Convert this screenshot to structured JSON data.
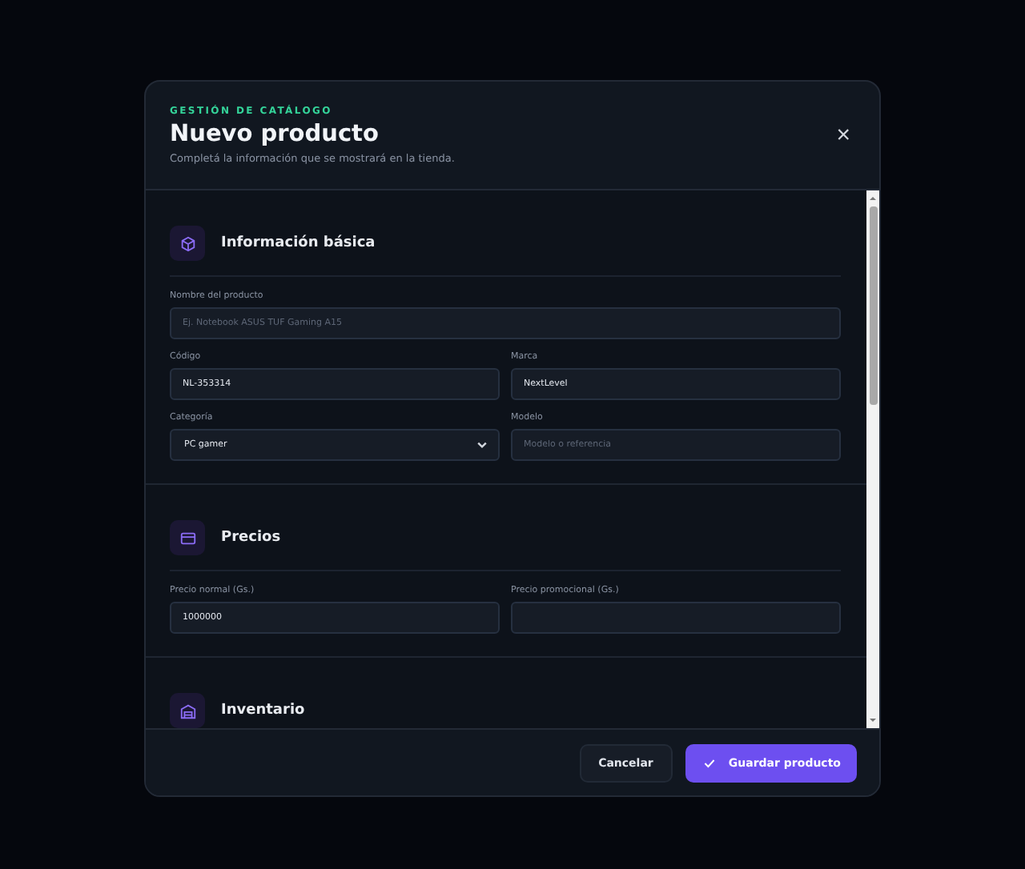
{
  "dialog": {
    "eyebrow": "GESTIÓN DE CATÁLOGO",
    "title": "Nuevo producto",
    "subtitle": "Completá la información que se mostrará en la tienda.",
    "close": "×"
  },
  "sections": [
    {
      "title": "Información básica",
      "rows": [
        [
          {
            "kind": "text",
            "label": "Nombre del producto",
            "placeholder": "Ej. Notebook ASUS TUF Gaming A15"
          }
        ],
        [
          {
            "kind": "text",
            "label": "Código",
            "value": "NL-353314"
          },
          {
            "kind": "text",
            "label": "Marca",
            "value": "NextLevel"
          }
        ],
        [
          {
            "kind": "select",
            "label": "Categoría",
            "value": "PC gamer"
          },
          {
            "kind": "text",
            "label": "Modelo",
            "placeholder": "Modelo o referencia"
          }
        ]
      ]
    },
    {
      "title": "Precios",
      "rows": [
        [
          {
            "kind": "text",
            "label": "Precio normal (Gs.)",
            "value": "1000000"
          },
          {
            "kind": "text",
            "label": "Precio promocional (Gs.)"
          }
        ]
      ]
    },
    {
      "title": "Inventario"
    }
  ],
  "buttons": [
    {
      "label": "Cancelar",
      "kind": "secondary"
    },
    {
      "label": "Guardar producto",
      "kind": "primary"
    }
  ]
}
